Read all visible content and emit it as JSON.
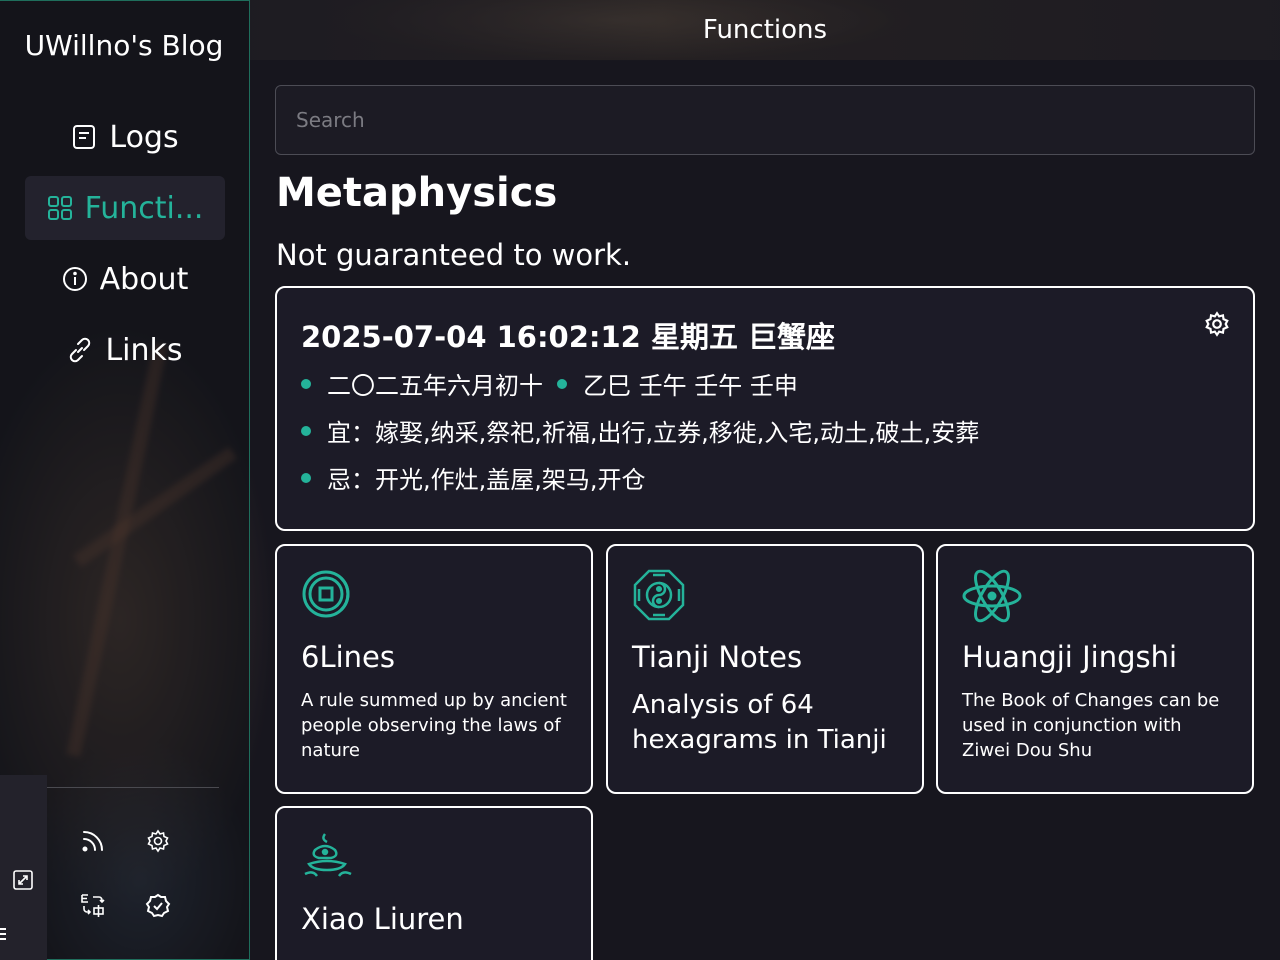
{
  "site": {
    "title": "UWillno's Blog"
  },
  "nav": {
    "items": [
      {
        "label": "Logs",
        "icon": "document-icon"
      },
      {
        "label": "Functi...",
        "icon": "grid-icon",
        "active": true
      },
      {
        "label": "About",
        "icon": "info-icon"
      },
      {
        "label": "Links",
        "icon": "link-icon"
      }
    ]
  },
  "sidebar_tools": [
    "rss-icon",
    "settings-icon",
    "translate-icon",
    "theme-settings-icon",
    "expand-icon",
    "menu-icon"
  ],
  "header": {
    "title": "Functions"
  },
  "search": {
    "placeholder": "Search"
  },
  "section": {
    "title": "Metaphysics",
    "subtitle": "Not guaranteed to work."
  },
  "calendar": {
    "datetime": "2025-07-04 16:02:12 星期五 巨蟹座",
    "lunar": "二〇二五年六月初十",
    "ganzhi": "乙巳 壬午 壬午 壬申",
    "yi": "宜：嫁娶,纳采,祭祀,祈福,出行,立券,移徙,入宅,动土,破土,安葬",
    "ji": "忌：开光,作灶,盖屋,架马,开仓"
  },
  "cards": [
    {
      "title": "6Lines",
      "desc": "A rule summed up by ancient people observing the laws of nature",
      "icon": "coin-icon"
    },
    {
      "title": "Tianji Notes",
      "desc": "Analysis of 64 hexagrams in Tianji",
      "icon": "bagua-icon"
    },
    {
      "title": "Huangji Jingshi",
      "desc": "The Book of Changes can be used in conjunction with Ziwei Dou Shu",
      "icon": "atom-icon"
    },
    {
      "title": "Xiao Liuren",
      "desc": "",
      "icon": "lamp-icon"
    }
  ],
  "colors": {
    "accent": "#24b39a",
    "background": "#16151d",
    "card": "#1c1b27",
    "sidebar_border": "#1f6e5c"
  }
}
